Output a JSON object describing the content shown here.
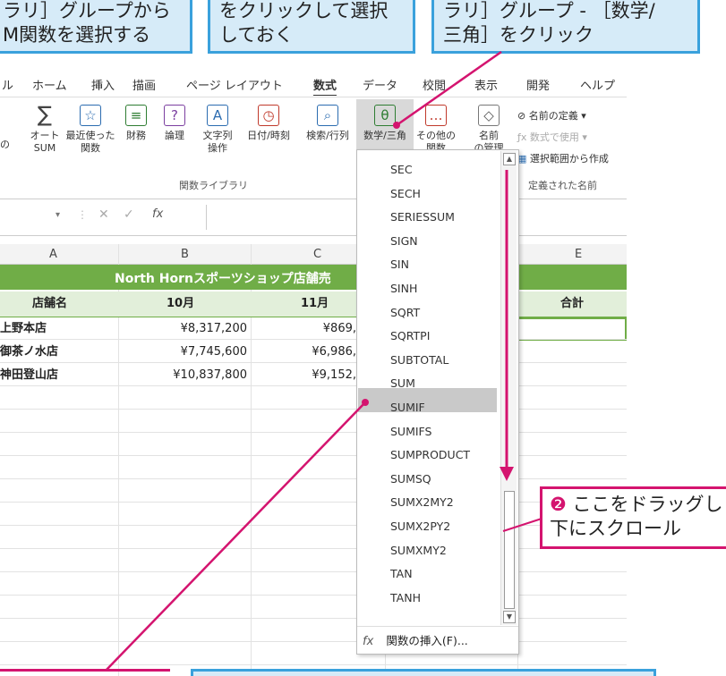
{
  "callouts": {
    "top_left": "ラリ］グループから\nM関数を選択する",
    "top_mid": "をクリックして選択\nしておく",
    "top_right": "ラリ］グループ - ［数学/\n三角］をクリック",
    "step2_num": "❷",
    "step2": " ここをドラッグし\n下にスクロール"
  },
  "ribbon": {
    "tabs": [
      "ル",
      "ホーム",
      "挿入",
      "描画",
      "ページ レイアウト",
      "数式",
      "データ",
      "校閲",
      "表示",
      "開発",
      "ヘルプ"
    ],
    "active_tab": "数式",
    "buttons": {
      "left_partial": "の",
      "autosum": "オート\nSUM",
      "recent": "最近使った\n関数",
      "finance": "財務",
      "logic": "論理",
      "text": "文字列\n操作",
      "datetime": "日付/時刻",
      "lookup": "検索/行列",
      "math": "数学/三角",
      "more": "その他の\n関数",
      "name_mgr": "名前\nの管理",
      "define_name": "名前の定義",
      "use_formula": "数式で使用",
      "from_selection": "選択範囲から作成"
    },
    "group_label": "関数ライブラリ",
    "group_label2": "定義された名前"
  },
  "formula_bar": {
    "fx": "fx"
  },
  "sheet": {
    "col_headers": [
      "A",
      "B",
      "C",
      "E"
    ],
    "title": "North Hornスポーツショップ店舗売",
    "header_row": [
      "店舗名",
      "10月",
      "11月",
      "合計"
    ],
    "rows": [
      [
        "上野本店",
        "¥8,317,200",
        "¥869,"
      ],
      [
        "御茶ノ水店",
        "¥7,745,600",
        "¥6,986,"
      ],
      [
        "神田登山店",
        "¥10,837,800",
        "¥9,152,"
      ]
    ]
  },
  "dropdown": {
    "items": [
      "SEC",
      "SECH",
      "SERIESSUM",
      "SIGN",
      "SIN",
      "SINH",
      "SQRT",
      "SQRTPI",
      "SUBTOTAL",
      "SUM",
      "SUMIF",
      "SUMIFS",
      "SUMPRODUCT",
      "SUMSQ",
      "SUMX2MY2",
      "SUMX2PY2",
      "SUMXMY2",
      "TAN",
      "TANH"
    ],
    "selected": "SUM",
    "footer": "関数の挿入(F)..."
  },
  "colors": {
    "accent_blue": "#3aa1dc",
    "accent_pink": "#d4146f",
    "sheet_green": "#70ad47"
  }
}
